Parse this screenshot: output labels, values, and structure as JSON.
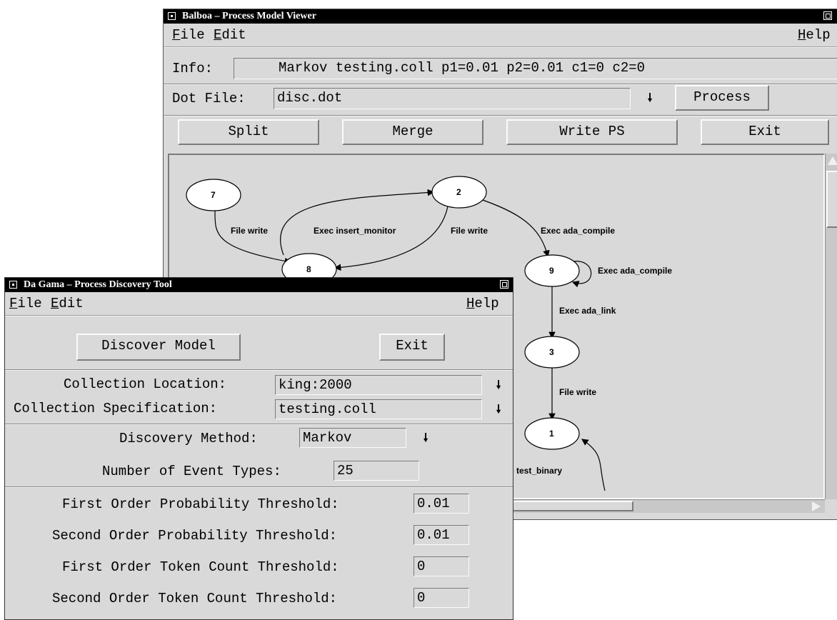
{
  "balboa": {
    "title": "Balboa – Process Model Viewer",
    "menu": {
      "file": "File",
      "edit": "Edit",
      "help": "Help"
    },
    "info_label": "Info:",
    "info_value": "Markov testing.coll p1=0.01 p2=0.01 c1=0 c2=0",
    "dotfile_label": "Dot File:",
    "dotfile_value": "disc.dot",
    "process_button": "Process",
    "buttons": {
      "split": "Split",
      "merge": "Merge",
      "write_ps": "Write PS",
      "exit": "Exit"
    },
    "graph": {
      "nodes": [
        "7",
        "2",
        "8",
        "9",
        "3",
        "1"
      ],
      "edges": [
        {
          "from": "7",
          "to": "8",
          "label": "File write"
        },
        {
          "from": "8",
          "to": "2",
          "label": "Exec insert_monitor"
        },
        {
          "from": "2",
          "to": "8",
          "label": "File write"
        },
        {
          "from": "2",
          "to": "9",
          "label": "Exec ada_compile"
        },
        {
          "from": "9",
          "to": "9",
          "label": "Exec ada_compile"
        },
        {
          "from": "9",
          "to": "3",
          "label": "Exec ada_link"
        },
        {
          "from": "3",
          "to": "1",
          "label": "File write"
        },
        {
          "from": "?",
          "to": "1",
          "label": "c test_binary"
        }
      ]
    }
  },
  "dagama": {
    "title": "Da Gama – Process Discovery Tool",
    "menu": {
      "file": "File",
      "edit": "Edit",
      "help": "Help"
    },
    "discover_button": "Discover Model",
    "exit_button": "Exit",
    "collection_location_label": "Collection Location:",
    "collection_location_value": "king:2000",
    "collection_spec_label": "Collection Specification:",
    "collection_spec_value": "testing.coll",
    "discovery_method_label": "Discovery Method:",
    "discovery_method_value": "Markov",
    "num_event_types_label": "Number of Event Types:",
    "num_event_types_value": "25",
    "first_prob_label": "First Order Probability Threshold:",
    "first_prob_value": "0.01",
    "second_prob_label": "Second Order Probability Threshold:",
    "second_prob_value": "0.01",
    "first_token_label": "First Order Token Count Threshold:",
    "first_token_value": "0",
    "second_token_label": "Second Order Token Count Threshold:",
    "second_token_value": "0"
  }
}
